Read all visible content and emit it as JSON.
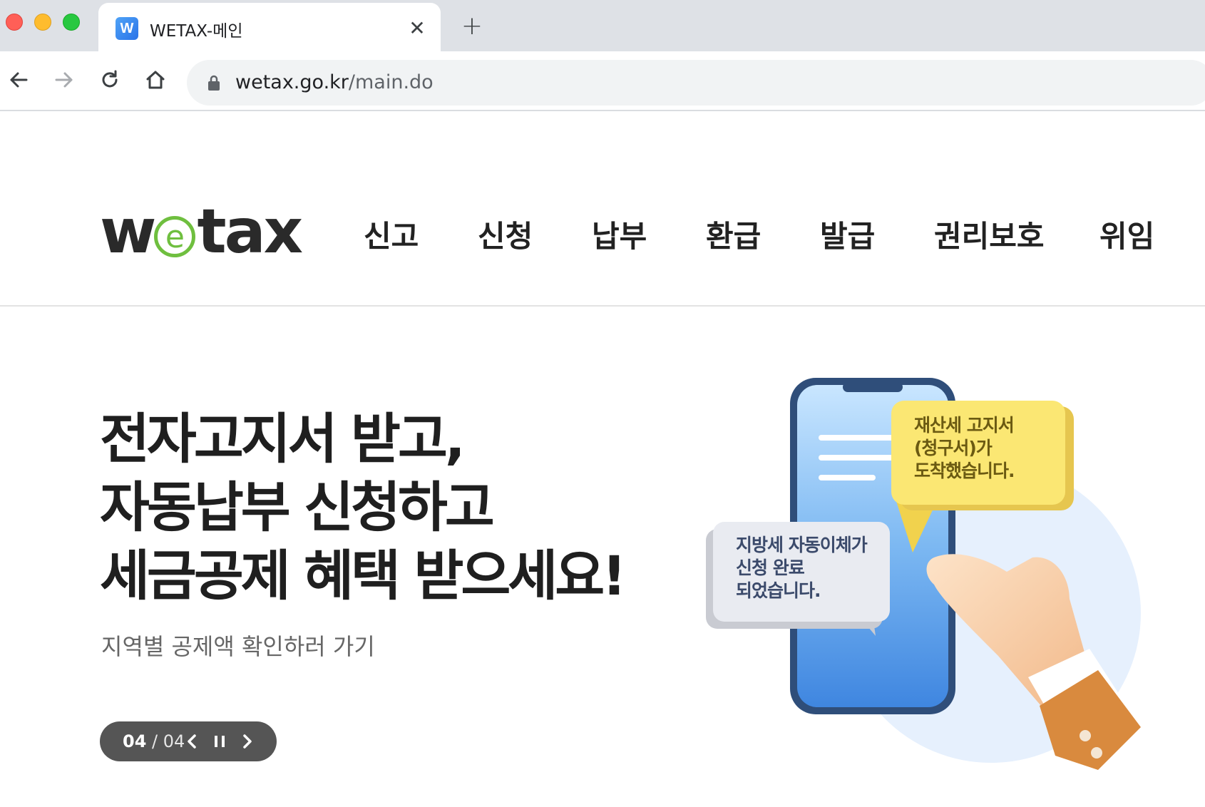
{
  "browser": {
    "tab": {
      "favicon": "W",
      "title": "WETAX-메인",
      "close_glyph": "✕"
    },
    "new_tab_glyph": "+",
    "url": {
      "host": "wetax.go.kr",
      "path": "/main.do"
    }
  },
  "site": {
    "logo": {
      "before": "w",
      "circle": "e",
      "after": "tax"
    },
    "nav": [
      "신고",
      "신청",
      "납부",
      "환급",
      "발급",
      "권리보호",
      "위임"
    ]
  },
  "hero": {
    "lines": [
      "전자고지서 받고,",
      "자동납부 신청하고",
      "세금공제 혜택 받으세요!"
    ],
    "sub": "지역별 공제액 확인하러 가기",
    "slider": {
      "current": "04",
      "separator": "/",
      "total": "04"
    },
    "bubble_yellow": [
      "재산세 고지서",
      "(청구서)가",
      "도착했습니다."
    ],
    "bubble_gray": [
      "지방세 자동이체가",
      "신청 완료",
      "되었습니다."
    ]
  },
  "colors": {
    "logo_green": "#6fbf3f",
    "bubble_yellow": "#fbe773",
    "phone_blue": "#4a90e2",
    "slider_bg": "#555555"
  },
  "icons": [
    "back-arrow-icon",
    "forward-arrow-icon",
    "reload-icon",
    "home-icon",
    "lock-icon",
    "prev-chevron-icon",
    "pause-icon",
    "next-chevron-icon"
  ]
}
